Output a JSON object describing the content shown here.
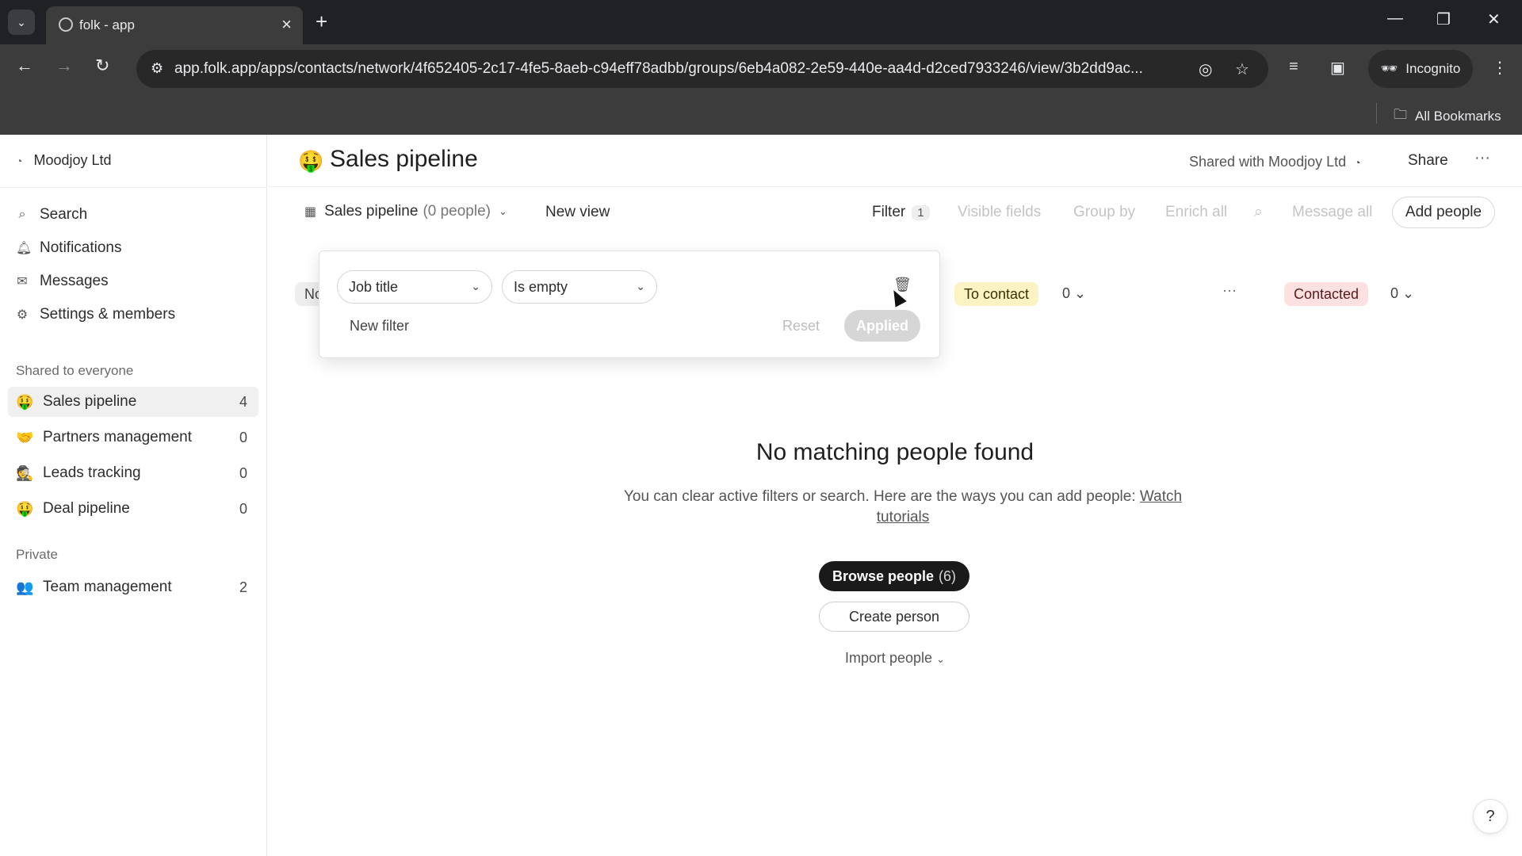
{
  "browser": {
    "tab_title": "folk - app",
    "url": "app.folk.app/apps/contacts/network/4f652405-2c17-4fe5-8aeb-c94eff78adbb/groups/6eb4a082-2e59-440e-aa4d-d2ced7933246/view/3b2dd9ac...",
    "incognito_label": "Incognito",
    "all_bookmarks_label": "All Bookmarks"
  },
  "sidebar": {
    "workspace": "Moodjoy Ltd",
    "links": [
      {
        "label": "Search",
        "icon": "search-icon"
      },
      {
        "label": "Notifications",
        "icon": "bell-icon"
      },
      {
        "label": "Messages",
        "icon": "mail-icon"
      },
      {
        "label": "Settings & members",
        "icon": "gear-icon"
      }
    ],
    "shared_section": "Shared to everyone",
    "shared_groups": [
      {
        "emoji": "🤑",
        "label": "Sales pipeline",
        "count": "4"
      },
      {
        "emoji": "🤝",
        "label": "Partners management",
        "count": "0"
      },
      {
        "emoji": "🕵",
        "label": "Leads tracking",
        "count": "0"
      },
      {
        "emoji": "🤑",
        "label": "Deal pipeline",
        "count": "0"
      }
    ],
    "private_section": "Private",
    "private_groups": [
      {
        "emoji": "👥",
        "label": "Team management",
        "count": "2"
      }
    ]
  },
  "header": {
    "emoji": "🤑",
    "title": "Sales pipeline",
    "shared_with": "Shared with Moodjoy Ltd",
    "share_label": "Share",
    "more_label": "···"
  },
  "viewbar": {
    "view_name": "Sales pipeline",
    "view_count": "(0 people)",
    "new_view": "New view",
    "filter_label": "Filter",
    "filter_count": "1",
    "visible_fields": "Visible fields",
    "group_by": "Group by",
    "enrich_all": "Enrich all",
    "message_all": "Message all",
    "add_people": "Add people"
  },
  "board": {
    "first_column_fragment": "No",
    "columns": [
      {
        "label": "To contact",
        "count": "0",
        "color": "#fbf3c1"
      },
      {
        "label": "Contacted",
        "count": "0",
        "color": "#fde0e0"
      }
    ],
    "dots": "···"
  },
  "filter_popup": {
    "field": "Job title",
    "operator": "Is empty",
    "new_filter": "New filter",
    "reset": "Reset",
    "applied": "Applied"
  },
  "empty_state": {
    "title": "No matching people found",
    "text": "You can clear active filters or search. Here are the ways you can add people:",
    "link": "Watch tutorials",
    "browse_label": "Browse people",
    "browse_count": "(6)",
    "create_label": "Create person",
    "import_label": "Import people"
  },
  "help_label": "?"
}
